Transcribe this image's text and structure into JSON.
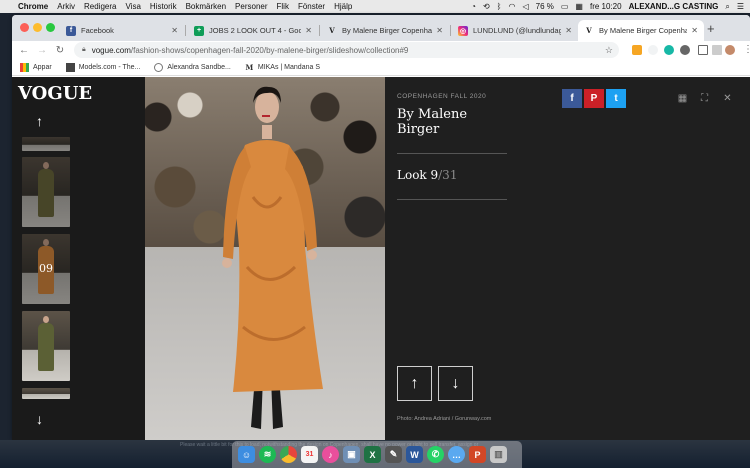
{
  "menubar": {
    "app": "Chrome",
    "items": [
      "Arkiv",
      "Redigera",
      "Visa",
      "Historik",
      "Bokmärken",
      "Personer",
      "Flik",
      "Fönster",
      "Hjälp"
    ],
    "battery": "76 %",
    "clock": "fre 10:20",
    "user": "ALEXAND...G CASTING"
  },
  "tabs": [
    {
      "title": "Facebook",
      "icon": "facebook-icon",
      "color": "#3b5998",
      "glyph": "f"
    },
    {
      "title": "JOBS 2 LOOK OUT 4 - Goo",
      "icon": "sheets-icon",
      "color": "#0f9d58",
      "glyph": "+"
    },
    {
      "title": "By Malene Birger Copenhag",
      "icon": "vogue-icon",
      "color": "#ffffff",
      "glyph": "V"
    },
    {
      "title": "LUNDLUND (@lundlundage",
      "icon": "instagram-icon",
      "color": "#c13584",
      "glyph": "◎"
    },
    {
      "title": "By Malene Birger Copenha",
      "icon": "vogue-icon",
      "color": "#ffffff",
      "glyph": "V"
    }
  ],
  "address": {
    "domain": "vogue.com",
    "path": "/fashion-shows/copenhagen-fall-2020/by-malene-birger/slideshow/collection#9"
  },
  "bookmarks": [
    {
      "label": "Appar",
      "icon": "apps-grid-icon"
    },
    {
      "label": "Models.com - The...",
      "icon": "folder-icon"
    },
    {
      "label": "Alexandra Sandbe...",
      "icon": "globe-icon"
    },
    {
      "label": "MIKAs | Mandana S",
      "icon": "m-logo-icon",
      "glyph": "M"
    }
  ],
  "vogue": {
    "logo": "VOGUE",
    "current_thumb_label": "09",
    "kicker": "COPENHAGEN FALL 2020",
    "title": "By Malene Birger",
    "look_prefix": "Look 9",
    "look_total": "/31",
    "credit": "Photo: Andrea Adriani / Gorunway.com",
    "share": [
      {
        "icon": "facebook-share-icon",
        "glyph": "f",
        "color": "#3b5998"
      },
      {
        "icon": "pinterest-share-icon",
        "glyph": "P",
        "color": "#cb2027"
      },
      {
        "icon": "twitter-share-icon",
        "glyph": "t",
        "color": "#1da1f2"
      }
    ],
    "dress_color": "#d9893e",
    "up_glyph": "↑",
    "down_glyph": "↓"
  },
  "dock_fade_text": "Please wait a little bit for this to load; notwithstanding the design on Copenhagen, shall have no power or right to sell transfer, assign or",
  "dock": [
    {
      "icon": "finder-icon",
      "color": "#3d8de0"
    },
    {
      "icon": "spotify-icon",
      "color": "#1db954"
    },
    {
      "icon": "chrome-icon",
      "color": "#e8453c"
    },
    {
      "icon": "calendar-icon",
      "color": "#f4f4f4"
    },
    {
      "icon": "itunes-icon",
      "color": "#e94f9c"
    },
    {
      "icon": "preview-icon",
      "color": "#6f8fb5"
    },
    {
      "icon": "excel-icon",
      "color": "#1f7244"
    },
    {
      "icon": "bbedit-icon",
      "color": "#555555"
    },
    {
      "icon": "word-icon",
      "color": "#2b579a"
    },
    {
      "icon": "whatsapp-icon",
      "color": "#25d366"
    },
    {
      "icon": "messages-icon",
      "color": "#5aa9f0"
    },
    {
      "icon": "powerpoint-icon",
      "color": "#d24726"
    },
    {
      "icon": "trash-icon",
      "color": "#c8c8c8"
    }
  ]
}
